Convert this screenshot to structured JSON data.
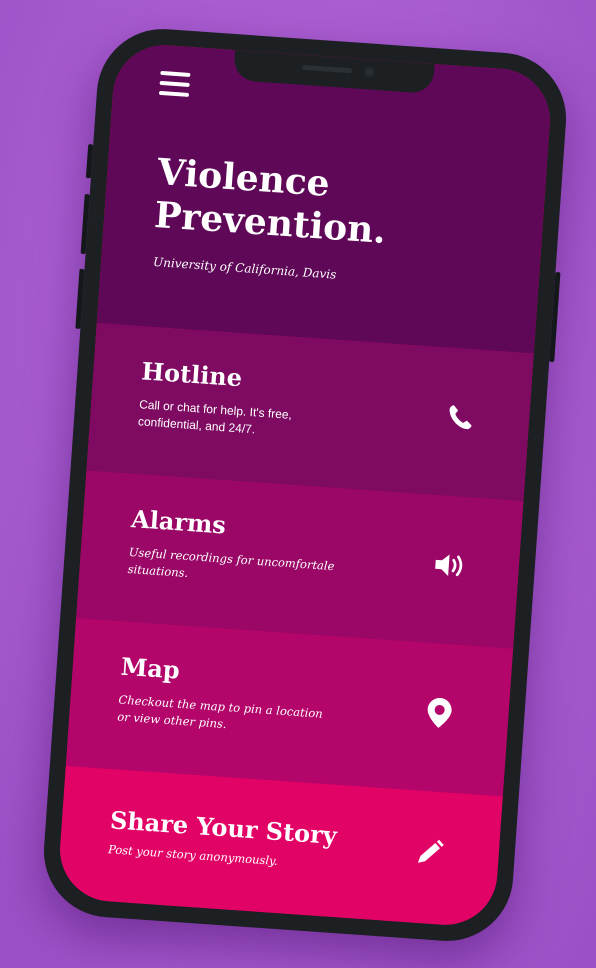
{
  "app": {
    "title_lines": [
      "Violence",
      "Prevention."
    ],
    "subtitle": "University of California, Davis"
  },
  "sections": [
    {
      "title": "Hotline",
      "description": "Call or chat for help. It's free, confidential, and 24/7.",
      "icon": "phone-icon"
    },
    {
      "title": "Alarms",
      "description": "Useful recordings  for uncomfortale situations.",
      "icon": "speaker-icon"
    },
    {
      "title": "Map",
      "description": "Checkout the map to pin a location or view other pins.",
      "icon": "map-pin-icon"
    },
    {
      "title": "Share Your Story",
      "description": "Post your story anonymously.",
      "icon": "pencil-icon"
    }
  ],
  "colors": {
    "background": "#a75bd0",
    "header": "#5f0858",
    "hotline": "#7e0a62",
    "alarms": "#9a0766",
    "map": "#b3056a",
    "story": "#e20366"
  }
}
